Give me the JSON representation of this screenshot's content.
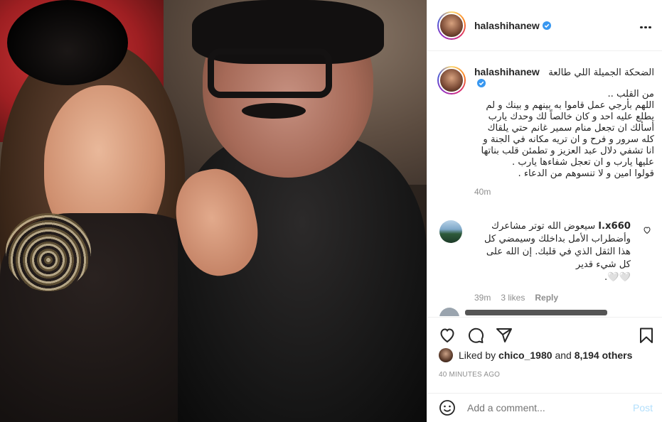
{
  "header": {
    "username": "halashihanew",
    "more_label": "More options"
  },
  "caption": {
    "username": "halashihanew",
    "first_line": "الضحكة الجميلة اللي طالعة",
    "text": "من القلب ..\nاللهم بأرجي عمل قاموا به بينهم و بينك و لم يطلع عليه احد و كان خالصاً لك وحدك يارب أسألك ان تجعل منام سمير غانم حتي يلقاك كله سرور و فرح و ان تريه مكانه في الجنة و انا تشفي دلال عبد العزيز و تطمئن قلب بناتها عليها يارب و ان تعجل شفاءها يارب .\nقولوا امين و لا تنسوهم من الدعاء .",
    "time": "40m"
  },
  "comment": {
    "username": "l.x660",
    "text": "سيعوض الله توتر مشاعرك\nوأضطراب الأمل بداخلك وسيمضي كل هذا الثقل الذي في قلبك. إن الله على كل شيء قدير\n🤍🤍.",
    "time": "39m",
    "likes": "3 likes",
    "reply": "Reply"
  },
  "likes": {
    "prefix": "Liked by",
    "user": "chico_1980",
    "middle": "and",
    "others": "8,194 others"
  },
  "timestamp": "40 MINUTES AGO",
  "add_comment": {
    "placeholder": "Add a comment...",
    "post": "Post"
  },
  "colors": {
    "verified": "#3897f0",
    "post_disabled": "#b2dffc",
    "muted": "#8e8e8e"
  },
  "icons": {
    "like": "heart-icon",
    "comment": "comment-icon",
    "share": "share-icon",
    "save": "bookmark-icon",
    "emoji": "emoji-icon"
  }
}
